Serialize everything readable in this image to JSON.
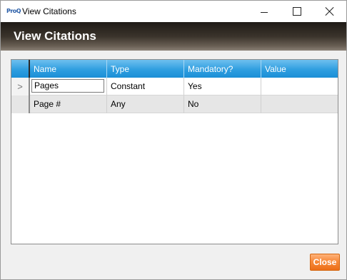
{
  "window": {
    "title": "View Citations",
    "app_icon": "app-logo-icon",
    "app_icon_text": "ProQ"
  },
  "header": {
    "title": "View Citations"
  },
  "grid": {
    "columns": [
      "Name",
      "Type",
      "Mandatory?",
      "Value"
    ],
    "rows": [
      {
        "selector": ">",
        "name": "Pages",
        "type": "Constant",
        "mandatory": "Yes",
        "value": ""
      },
      {
        "selector": "",
        "name": "Page #",
        "type": "Any",
        "mandatory": "No",
        "value": ""
      }
    ]
  },
  "footer": {
    "close_label": "Close"
  },
  "colors": {
    "header_blue": "#2f9ee0",
    "close_orange": "#f7893a",
    "title_band": "#3a332b"
  }
}
